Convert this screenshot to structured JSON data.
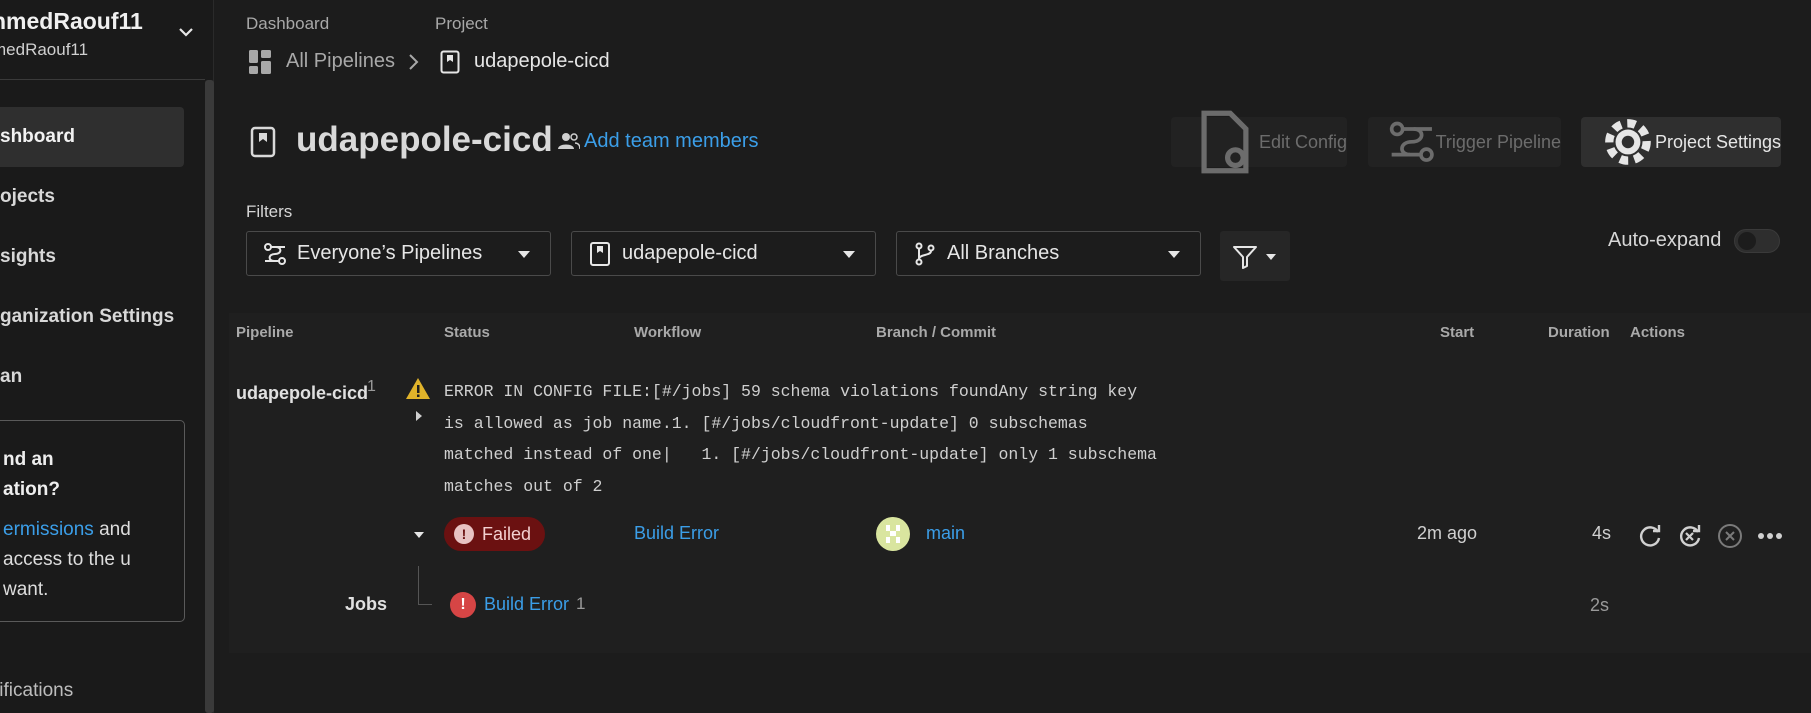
{
  "sidebar": {
    "org_name": "nmedRaouf11",
    "org_sub": "medRaouf11",
    "nav": [
      {
        "label": "shboard",
        "active": true
      },
      {
        "label": "ojects",
        "active": false
      },
      {
        "label": "sights",
        "active": false
      },
      {
        "label": "ganization Settings",
        "active": false
      },
      {
        "label": "an",
        "active": false
      }
    ],
    "promo": {
      "title": "nd an\nation?",
      "link_text": "ermissions",
      "body_after_link": " and access to the u want."
    },
    "notifications": "tifications"
  },
  "breadcrumb": {
    "dashboard_label": "Dashboard",
    "project_label": "Project",
    "all_pipelines": "All Pipelines",
    "project_name": "udapepole-cicd"
  },
  "header": {
    "title": "udapepole-cicd",
    "add_team": "Add team members",
    "edit_config": "Edit Config",
    "trigger_pipeline": "Trigger Pipeline",
    "project_settings": "Project Settings"
  },
  "filters": {
    "label": "Filters",
    "pipelines": "Everyone’s Pipelines",
    "project": "udapepole-cicd",
    "branches": "All Branches",
    "auto_expand": "Auto-expand",
    "auto_expand_on": false
  },
  "table": {
    "headers": [
      "Pipeline",
      "Status",
      "Workflow",
      "Branch / Commit",
      "Start",
      "Duration",
      "Actions"
    ],
    "row": {
      "pipeline": "udapepole-cicd",
      "number": "1",
      "error": "ERROR IN CONFIG FILE:[#/jobs] 59 schema violations foundAny string key\nis allowed as job name.1. [#/jobs/cloudfront-update] 0 subschemas\nmatched instead of one|   1. [#/jobs/cloudfront-update] only 1 subschema\nmatches out of 2",
      "status": "Failed",
      "workflow": "Build Error",
      "branch": "main",
      "start": "2m ago",
      "duration": "4s"
    },
    "jobs": {
      "label": "Jobs",
      "job_name": "Build Error",
      "job_num": "1",
      "duration": "2s"
    }
  },
  "colors": {
    "accent": "#3b9ee8",
    "failed_bg": "#6b1111",
    "warning": "#e0b32a"
  }
}
